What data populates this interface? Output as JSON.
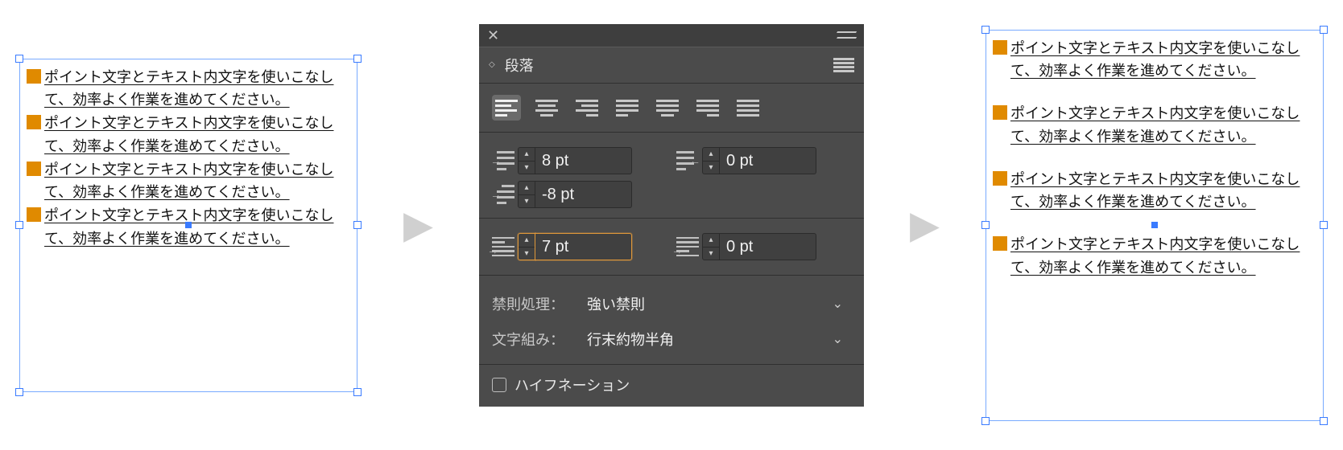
{
  "before": {
    "items": [
      "ポイント文字とテキスト内文字を使いこなして、効率よく作業を進めてください。",
      "ポイント文字とテキスト内文字を使いこなして、効率よく作業を進めてください。",
      "ポイント文字とテキスト内文字を使いこなして、効率よく作業を進めてください。",
      "ポイント文字とテキスト内文字を使いこなして、効率よく作業を進めてください。"
    ]
  },
  "after": {
    "items": [
      "ポイント文字とテキスト内文字を使いこなして、効率よく作業を進めてください。",
      "ポイント文字とテキスト内文字を使いこなして、効率よく作業を進めてください。",
      "ポイント文字とテキスト内文字を使いこなして、効率よく作業を進めてください。",
      "ポイント文字とテキスト内文字を使いこなして、効率よく作業を進めてください。"
    ]
  },
  "panel": {
    "title": "段落",
    "align_icons": [
      "align-left",
      "align-center",
      "align-right",
      "justify-left",
      "justify-center",
      "justify-right",
      "justify-all"
    ],
    "indent": {
      "left": "8 pt",
      "right": "0 pt",
      "first_line": "-8 pt",
      "space_before": "7 pt",
      "space_after": "0 pt"
    },
    "kinsoku": {
      "label": "禁則処理：",
      "value": "強い禁則"
    },
    "mojikumi": {
      "label": "文字組み：",
      "value": "行末約物半角"
    },
    "hyphenation": {
      "label": "ハイフネーション",
      "checked": false
    }
  }
}
